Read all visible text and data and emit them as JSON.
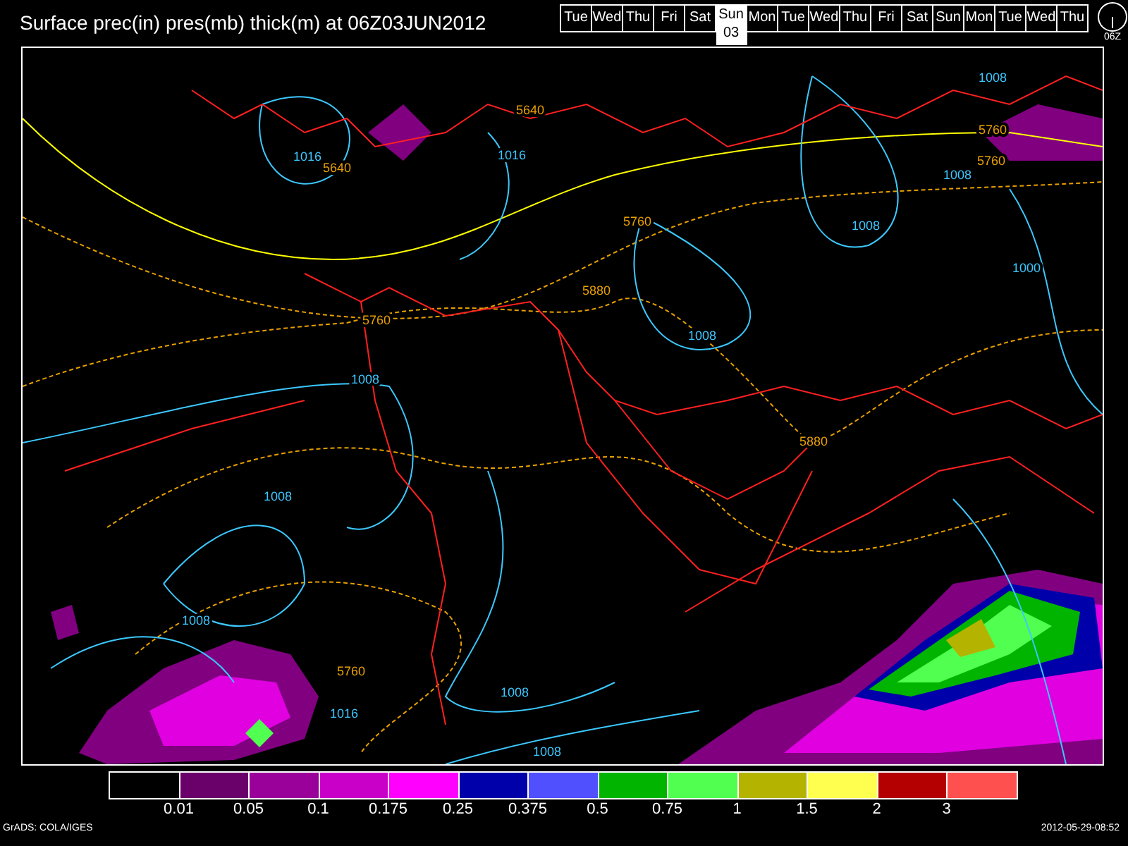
{
  "title": "Surface prec(in) pres(mb) thick(m) at 06Z03JUN2012",
  "timeline": {
    "days": [
      {
        "label": "Tue",
        "selected": false
      },
      {
        "label": "Wed",
        "selected": false
      },
      {
        "label": "Thu",
        "selected": false
      },
      {
        "label": "Fri",
        "selected": false
      },
      {
        "label": "Sat",
        "selected": false
      },
      {
        "label": "Sun",
        "selected": true
      },
      {
        "label": "Mon",
        "selected": false
      },
      {
        "label": "Tue",
        "selected": false
      },
      {
        "label": "Wed",
        "selected": false
      },
      {
        "label": "Thu",
        "selected": false
      },
      {
        "label": "Fri",
        "selected": false
      },
      {
        "label": "Sat",
        "selected": false
      },
      {
        "label": "Sun",
        "selected": false
      },
      {
        "label": "Mon",
        "selected": false
      },
      {
        "label": "Tue",
        "selected": false
      },
      {
        "label": "Wed",
        "selected": false
      },
      {
        "label": "Thu",
        "selected": false
      }
    ],
    "selected_date": "03",
    "time": "06Z"
  },
  "map": {
    "contour_labels": [
      {
        "text": "5640",
        "kind": "thickness"
      },
      {
        "text": "1016",
        "kind": "pressure"
      },
      {
        "text": "5640",
        "kind": "thickness"
      },
      {
        "text": "1016",
        "kind": "pressure"
      },
      {
        "text": "1008",
        "kind": "pressure"
      },
      {
        "text": "5760",
        "kind": "thickness"
      },
      {
        "text": "5760",
        "kind": "thickness"
      },
      {
        "text": "1008",
        "kind": "pressure"
      },
      {
        "text": "1008",
        "kind": "pressure"
      },
      {
        "text": "5760",
        "kind": "thickness"
      },
      {
        "text": "1000",
        "kind": "pressure"
      },
      {
        "text": "5880",
        "kind": "thickness"
      },
      {
        "text": "1008",
        "kind": "pressure"
      },
      {
        "text": "5760",
        "kind": "thickness"
      },
      {
        "text": "1008",
        "kind": "pressure"
      },
      {
        "text": "5880",
        "kind": "thickness"
      },
      {
        "text": "1008",
        "kind": "pressure"
      },
      {
        "text": "1008",
        "kind": "pressure"
      },
      {
        "text": "5760",
        "kind": "thickness"
      },
      {
        "text": "1016",
        "kind": "pressure"
      },
      {
        "text": "1008",
        "kind": "pressure"
      },
      {
        "text": "1008",
        "kind": "pressure"
      }
    ]
  },
  "legend": {
    "colors": [
      {
        "color": "#000000"
      },
      {
        "color": "#6a006a"
      },
      {
        "color": "#9a009a"
      },
      {
        "color": "#c800c8"
      },
      {
        "color": "#ff00ff"
      },
      {
        "color": "#0000aa"
      },
      {
        "color": "#5050ff"
      },
      {
        "color": "#00b400"
      },
      {
        "color": "#50ff50"
      },
      {
        "color": "#b4b400"
      },
      {
        "color": "#ffff50"
      },
      {
        "color": "#b40000"
      },
      {
        "color": "#ff5050"
      }
    ],
    "labels": [
      "0.01",
      "0.05",
      "0.1",
      "0.175",
      "0.25",
      "0.375",
      "0.5",
      "0.75",
      "1",
      "1.5",
      "2",
      "3"
    ]
  },
  "footer": {
    "credit": "GrADS: COLA/IGES",
    "timestamp": "2012-05-29-08:52"
  }
}
